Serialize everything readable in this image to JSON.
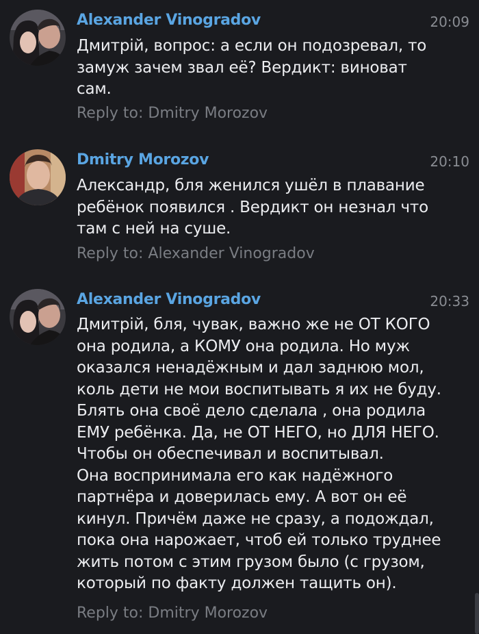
{
  "messages": [
    {
      "author": "Alexander Vinogradov",
      "time": "20:09",
      "avatar": "couple-avatar",
      "lines": [
        "Дмитрій, вопрос: а если он подозревал, то",
        "замуж зачем звал её? Вердикт: виноват",
        "сам."
      ],
      "reply": "Reply to: Dmitry Morozov"
    },
    {
      "author": "Dmitry Morozov",
      "time": "20:10",
      "avatar": "man-avatar",
      "lines": [
        "Александр,  бля женился  ушёл в плавание",
        "ребёнок появился . Вердикт он незнал что",
        "там с ней на суше."
      ],
      "reply": "Reply to: Alexander Vinogradov"
    },
    {
      "author": "Alexander Vinogradov",
      "time": "20:33",
      "avatar": "couple-avatar",
      "lines": [
        "Дмитрій, бля, чувак, важно же не ОТ КОГО",
        "она родила, а КОМУ она родила. Но муж",
        "оказался ненадёжным и дал заднюю мол,",
        "коль дети не мои воспитывать я их не буду.",
        "Блять она своё дело сделала , она родила",
        "ЕМУ ребёнка. Да, не ОТ НЕГО, но ДЛЯ НЕГО.",
        "Чтобы он обеспечивал и воспитывал.",
        "Она воспринимала его как надёжного",
        "партнёра и доверилась ему. А вот он её",
        "кинул. Причём даже не сразу, а подождал,",
        "пока она нарожает, чтоб ей только труднее",
        "жить потом с этим грузом было (с грузом,",
        "который по факту должен тащить он)."
      ],
      "reply": "Reply to: Dmitry Morozov"
    }
  ],
  "colors": {
    "background": "#1a1b1f",
    "author": "#5aa5e2",
    "text": "#ecedf0",
    "time": "#8a8d93",
    "reply": "#7a7d83"
  }
}
